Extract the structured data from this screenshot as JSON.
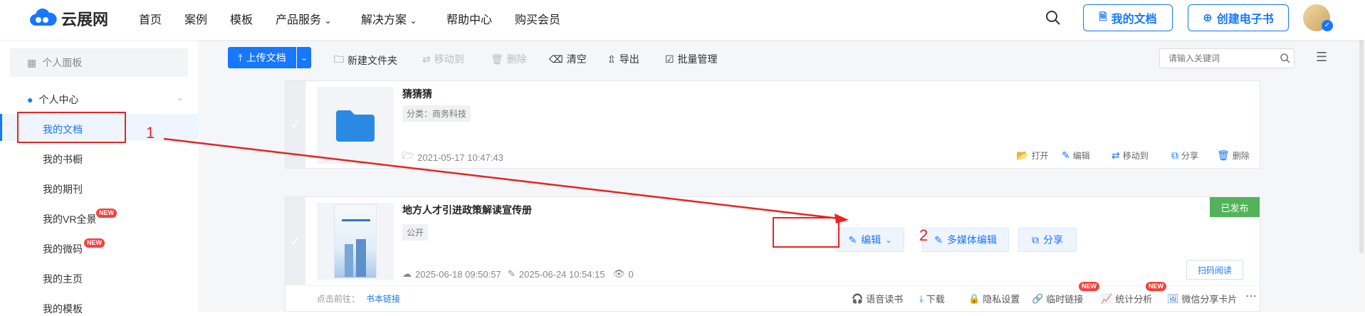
{
  "header": {
    "logo_text": "云展网",
    "nav": [
      "首页",
      "案例",
      "模板",
      "产品服务",
      "解决方案",
      "帮助中心",
      "购买会员"
    ],
    "my_docs_button": "我的文档",
    "create_book_button": "创建电子书"
  },
  "sidebar": {
    "panel_label": "个人面板",
    "center_label": "个人中心",
    "items": [
      "我的文档",
      "我的书橱",
      "我的期刊",
      "我的VR全景",
      "我的微码",
      "我的主页",
      "我的模板"
    ],
    "new_badge": "NEW"
  },
  "toolbar": {
    "upload": "上传文档",
    "new_folder": "新建文件夹",
    "move_to": "移动到",
    "delete": "删除",
    "clear": "清空",
    "export": "导出",
    "batch": "批量管理",
    "search_placeholder": "请输入关键词"
  },
  "folder_card": {
    "title": "猜猜猜",
    "category": "分类：商务科技",
    "date": "2021-05-17 10:47:43",
    "actions": [
      "打开",
      "编辑",
      "移动到",
      "分享",
      "删除"
    ]
  },
  "doc_card": {
    "title": "地方人才引进政策解读宣传册",
    "visibility": "公开",
    "created": "2025-06-18 09:50:57",
    "modified": "2025-06-24 10:54:15",
    "views": "0",
    "status": "已发布",
    "edit_button": "编辑",
    "media_edit_button": "多媒体编辑",
    "share_button": "分享",
    "scan_read": "扫码阅读",
    "goto_label": "点击前往：",
    "book_link": "书本链接",
    "bottom_actions": [
      "语音读书",
      "下载",
      "隐私设置",
      "临时链接",
      "统计分析",
      "微信分享卡片"
    ]
  },
  "annotations": {
    "step1": "1",
    "step2": "2"
  },
  "colors": {
    "accent": "#1677ff",
    "highlight": "#e8231f",
    "published": "#52b35a"
  }
}
